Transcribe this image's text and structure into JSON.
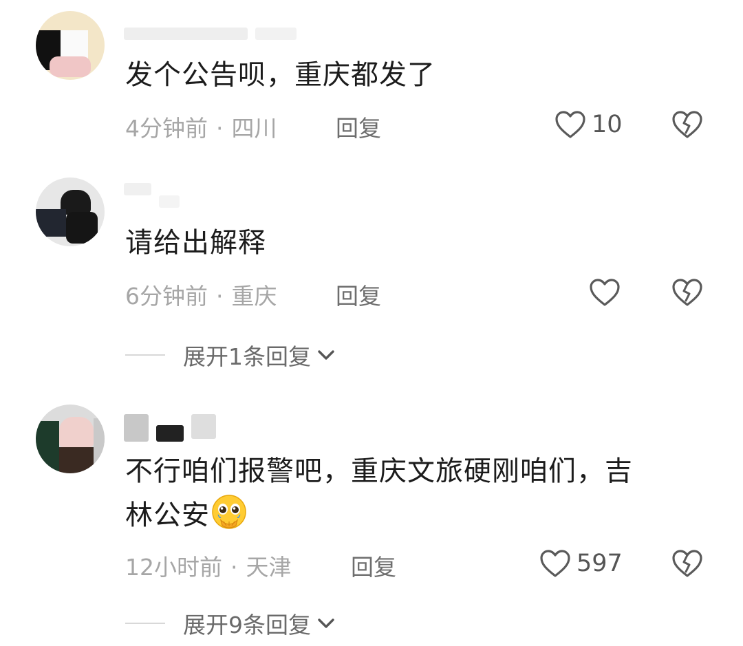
{
  "comments": [
    {
      "text": "发个公告呗，重庆都发了",
      "time": "4分钟前",
      "location": "四川",
      "reply_label": "回复",
      "likes": "10"
    },
    {
      "text": "请给出解释",
      "time": "6分钟前",
      "location": "重庆",
      "reply_label": "回复",
      "likes": "",
      "expand_label": "展开1条回复"
    },
    {
      "text_line1": "不行咱们报警吧，重庆文旅硬刚咱们，吉",
      "text_line2": "林公安",
      "time": "12小时前",
      "location": "天津",
      "reply_label": "回复",
      "likes": "597",
      "expand_label": "展开9条回复"
    }
  ],
  "icons": {
    "like": "heart-outline-icon",
    "dislike": "broken-heart-icon",
    "expand": "chevron-down-icon",
    "emoji": "pleading-face-emoji"
  },
  "colors": {
    "meta": "#a6a6a6",
    "reply": "#6e6e6e",
    "text": "#1c1c1c"
  }
}
